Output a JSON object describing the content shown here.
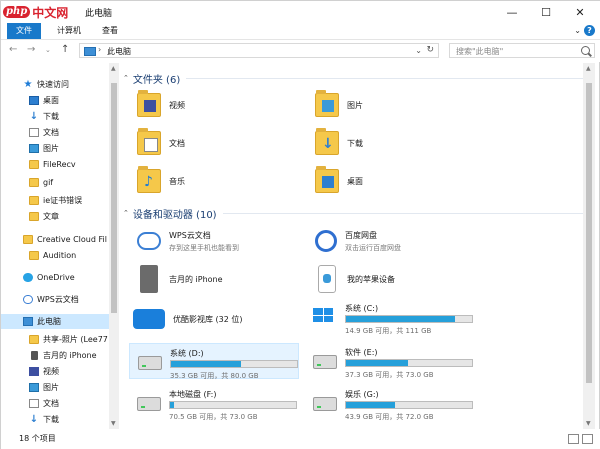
{
  "app": {
    "watermark_php": "php",
    "watermark_cn": "中文网",
    "title": "此电脑"
  },
  "window_controls": {
    "minimize": "—",
    "maximize": "☐",
    "close": "✕"
  },
  "ribbon": {
    "tabs": [
      {
        "label": "文件"
      },
      {
        "label": "计算机"
      },
      {
        "label": "查看"
      }
    ],
    "help": "?"
  },
  "address": {
    "path": "此电脑",
    "search_placeholder": "搜索\"此电脑\""
  },
  "nav": {
    "items": [
      {
        "label": "快速访问",
        "icon": "star-icon"
      },
      {
        "label": "桌面",
        "icon": "desktop-icon",
        "pinned": true
      },
      {
        "label": "下载",
        "icon": "download-icon",
        "pinned": true
      },
      {
        "label": "文档",
        "icon": "documents-icon",
        "pinned": true
      },
      {
        "label": "图片",
        "icon": "pictures-icon",
        "pinned": true
      },
      {
        "label": "FileRecv",
        "icon": "folder-icon"
      },
      {
        "label": "gif",
        "icon": "folder-icon"
      },
      {
        "label": "ie证书错误",
        "icon": "folder-icon"
      },
      {
        "label": "文章",
        "icon": "folder-icon"
      },
      {
        "label": "Creative Cloud Fil",
        "icon": "creative-cloud-icon"
      },
      {
        "label": "Audition",
        "icon": "folder-icon"
      },
      {
        "label": "OneDrive",
        "icon": "onedrive-icon"
      },
      {
        "label": "WPS云文档",
        "icon": "wps-cloud-icon"
      },
      {
        "label": "此电脑",
        "icon": "computer-icon",
        "selected": true
      },
      {
        "label": "共享-照片 (Lee77",
        "icon": "folder-icon"
      },
      {
        "label": "吉月的 iPhone",
        "icon": "phone-icon"
      },
      {
        "label": "视频",
        "icon": "videos-icon"
      },
      {
        "label": "图片",
        "icon": "pictures-icon"
      },
      {
        "label": "文档",
        "icon": "documents-icon"
      },
      {
        "label": "下载",
        "icon": "download-icon"
      }
    ]
  },
  "folders": {
    "header": "文件夹 (6)",
    "items": [
      {
        "label": "视频",
        "icon": "videos-folder-icon"
      },
      {
        "label": "图片",
        "icon": "pictures-folder-icon"
      },
      {
        "label": "文档",
        "icon": "documents-folder-icon"
      },
      {
        "label": "下载",
        "icon": "downloads-folder-icon"
      },
      {
        "label": "音乐",
        "icon": "music-folder-icon"
      },
      {
        "label": "桌面",
        "icon": "desktop-folder-icon"
      }
    ]
  },
  "devices": {
    "header": "设备和驱动器 (10)",
    "items": [
      {
        "label": "WPS云文档",
        "sub": "存到这里手机也能看到",
        "icon": "wps-cloud-icon"
      },
      {
        "label": "百度网盘",
        "sub": "双击运行百度网盘",
        "icon": "baidu-netdisk-icon"
      },
      {
        "label": "吉月的 iPhone",
        "sub": "",
        "icon": "iphone-icon"
      },
      {
        "label": "我的苹果设备",
        "sub": "",
        "icon": "apple-device-icon"
      },
      {
        "label": "优酷影视库 (32 位)",
        "sub": "",
        "icon": "youku-icon"
      }
    ],
    "drives": [
      {
        "name": "系统 (C:)",
        "free": "14.9 GB 可用，共 111 GB",
        "used_fraction": 0.866,
        "selected": false
      },
      {
        "name": "系统 (D:)",
        "free": "35.3 GB 可用，共 80.0 GB",
        "used_fraction": 0.559,
        "selected": true
      },
      {
        "name": "软件 (E:)",
        "free": "37.3 GB 可用，共 73.0 GB",
        "used_fraction": 0.489,
        "selected": false
      },
      {
        "name": "本地磁盘 (F:)",
        "free": "70.5 GB 可用，共 73.0 GB",
        "used_fraction": 0.034,
        "selected": false
      },
      {
        "name": "娱乐 (G:)",
        "free": "43.9 GB 可用，共 72.0 GB",
        "used_fraction": 0.39,
        "selected": false
      }
    ]
  },
  "status": {
    "count": "18 个项目"
  },
  "colors": {
    "accent": "#1979ca",
    "drive_bar": "#26a0da",
    "selection": "#cce8ff"
  }
}
